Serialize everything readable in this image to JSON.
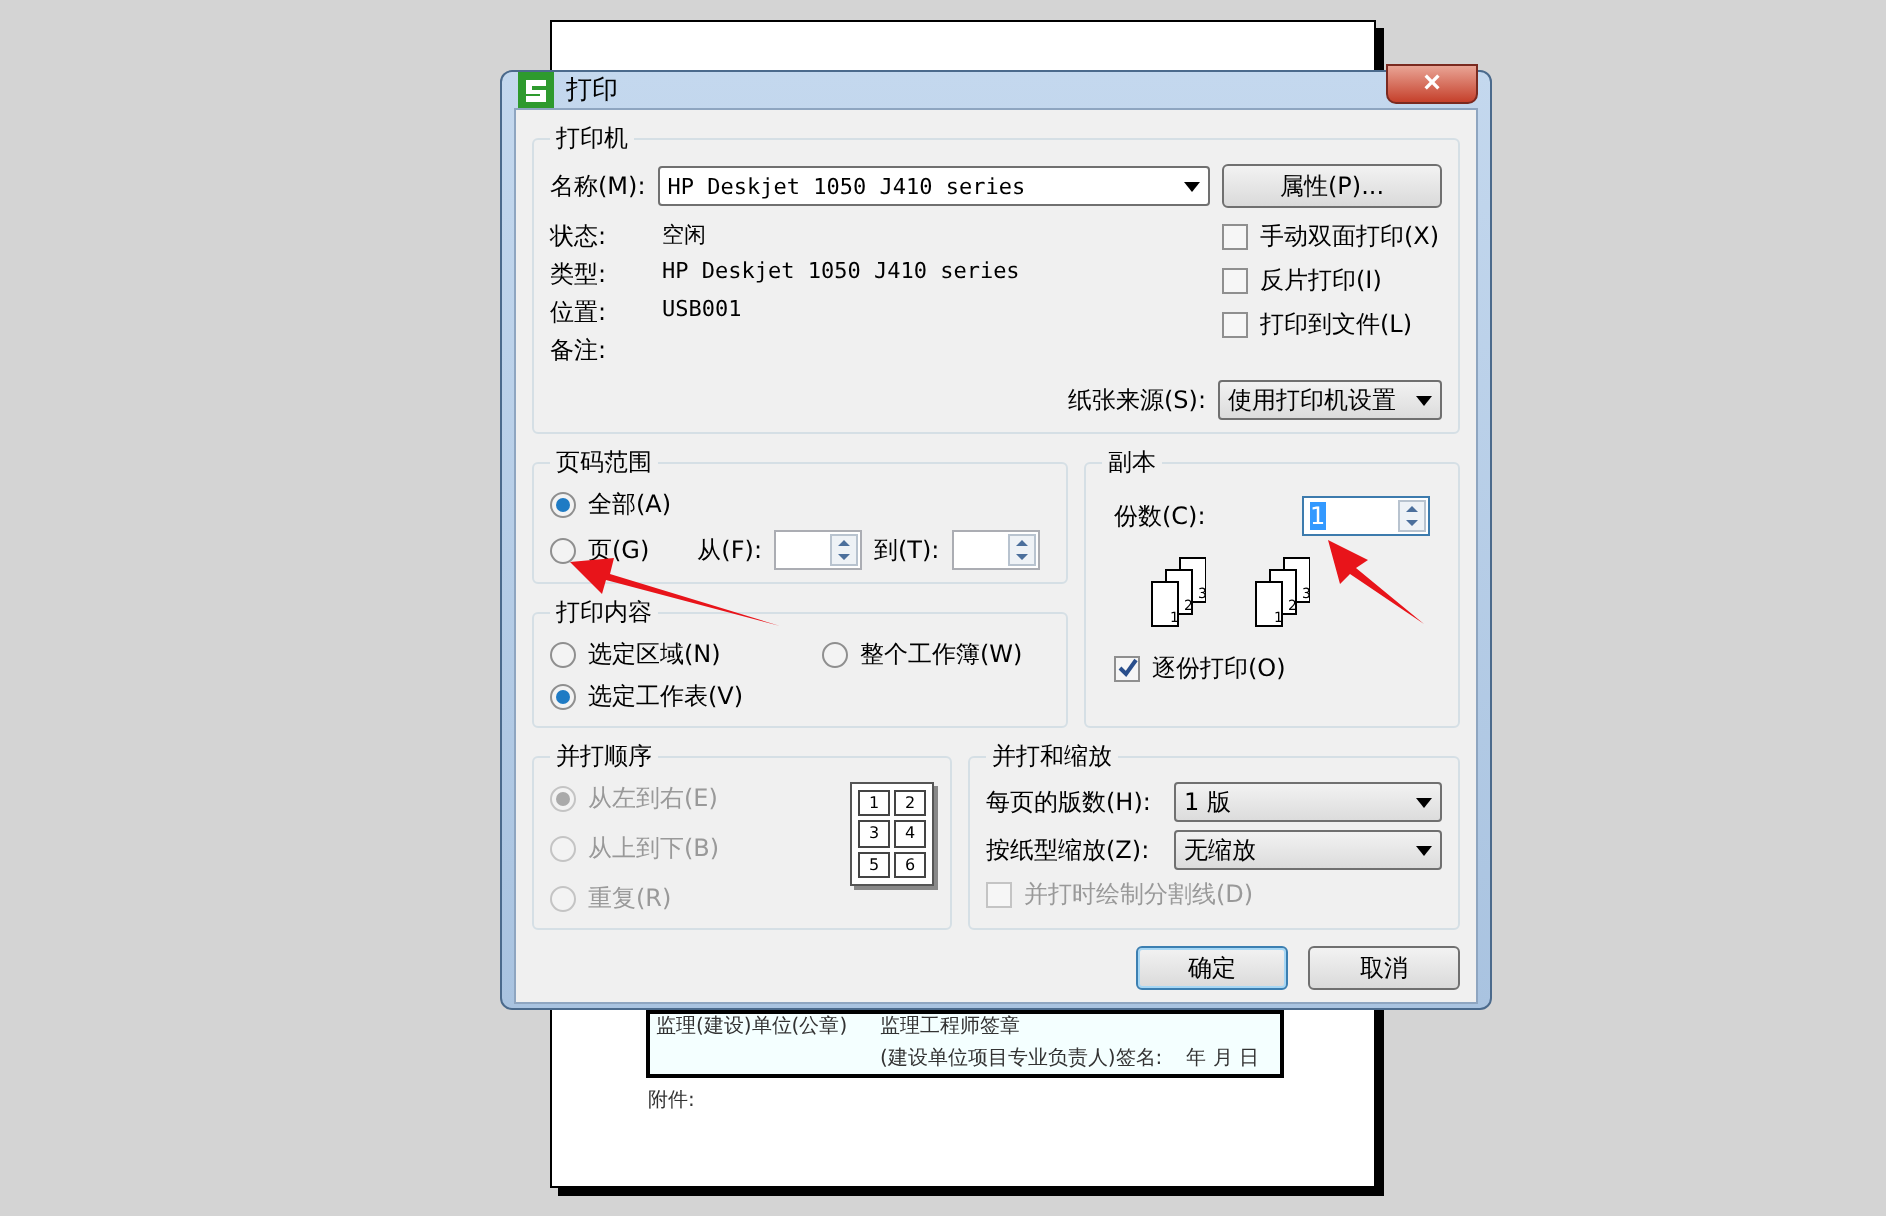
{
  "window": {
    "title": "打印",
    "close": "×"
  },
  "printer": {
    "title": "打印机",
    "name_label": "名称(M):",
    "name_value": "HP Deskjet 1050 J410 series",
    "properties_button": "属性(P)...",
    "info": [
      {
        "label": "状态:",
        "value": "空闲"
      },
      {
        "label": "类型:",
        "value": "HP Deskjet 1050 J410 series"
      },
      {
        "label": "位置:",
        "value": "USB001"
      },
      {
        "label": "备注:"
      }
    ],
    "options": [
      {
        "label": "手动双面打印(X)",
        "checked": false
      },
      {
        "label": "反片打印(I)",
        "checked": false
      },
      {
        "label": "打印到文件(L)",
        "checked": false
      }
    ],
    "source_label": "纸张来源(S):",
    "source_value": "使用打印机设置"
  },
  "page_range": {
    "title": "页码范围",
    "options": [
      {
        "label": "全部(A)",
        "selected": true
      },
      {
        "label": "页(G)",
        "selected": false
      }
    ],
    "from_label": "从(F):",
    "to_label": "到(T):"
  },
  "copies": {
    "title": "副本",
    "count_label": "份数(C):",
    "count_value": "1",
    "stacks": [
      [
        "1",
        "2",
        "3"
      ],
      [
        "1",
        "2",
        "3"
      ]
    ],
    "collate_label": "逐份打印(O)",
    "collate": true
  },
  "print_content": {
    "title": "打印内容",
    "options": [
      {
        "label": "选定区域(N)",
        "selected": false
      },
      {
        "label": "整个工作簿(W)",
        "selected": false
      },
      {
        "label": "选定工作表(V)",
        "selected": true
      }
    ]
  },
  "order": {
    "title": "并打顺序",
    "disabled": true,
    "options": [
      {
        "label": "从左到右(E)",
        "selected": true
      },
      {
        "label": "从上到下(B)",
        "selected": false
      },
      {
        "label": "重复(R)",
        "selected": false
      }
    ],
    "grid": [
      "1",
      "2",
      "3",
      "4",
      "5",
      "6"
    ]
  },
  "scaling": {
    "title": "并打和缩放",
    "fields": [
      {
        "label": "每页的版数(H):",
        "value": "1 版"
      },
      {
        "label": "按纸型缩放(Z):",
        "value": "无缩放"
      }
    ],
    "divider_label": "并打时绘制分割线(D)",
    "divider_checked": false,
    "divider_disabled": true
  },
  "buttons": [
    {
      "label": "确定",
      "default": true
    },
    {
      "label": "取消",
      "default": false
    }
  ],
  "document": {
    "cells": [
      "监理(建设)单位(公章)",
      "监理工程师签章",
      "(建设单位项目专业负责人)签名:",
      "年  月  日"
    ],
    "footer": "附件:"
  }
}
